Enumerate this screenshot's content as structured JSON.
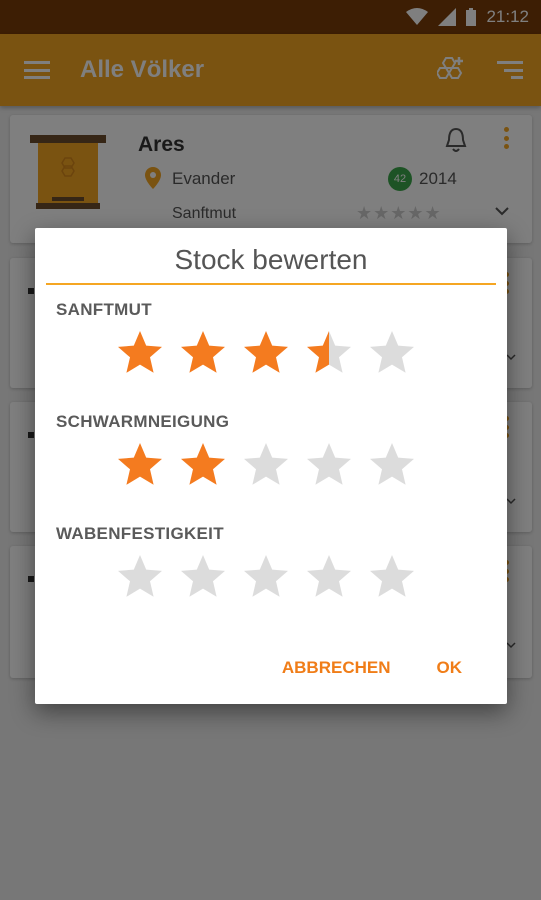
{
  "status_bar": {
    "time": "21:12"
  },
  "toolbar": {
    "title": "Alle Völker"
  },
  "hive_card": {
    "name": "Ares",
    "location": "Evander",
    "badge_count": "42",
    "year": "2014",
    "rating_label": "Sanftmut",
    "rating_value": 0
  },
  "dialog": {
    "title": "Stock bewerten",
    "categories": [
      {
        "label": "SANFTMUT",
        "rating": 3.5
      },
      {
        "label": "SCHWARMNEIGUNG",
        "rating": 2
      },
      {
        "label": "WABENFESTIGKEIT",
        "rating": 0
      }
    ],
    "max_stars": 5,
    "cancel_label": "ABBRECHEN",
    "ok_label": "OK"
  },
  "colors": {
    "accent": "#f5a623",
    "star_filled": "#f47b1f",
    "star_empty": "#dcdcdc",
    "status_bar": "#7a3c08"
  }
}
